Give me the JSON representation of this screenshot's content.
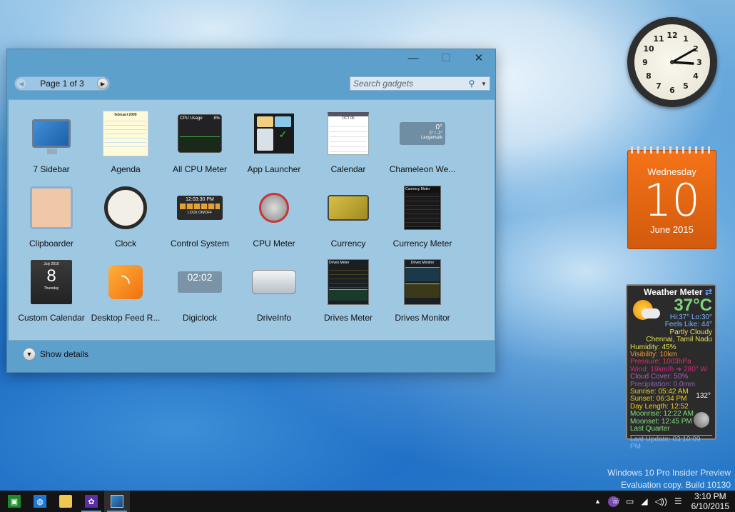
{
  "desktop": {
    "watermark_line1": "Windows 10 Pro Insider Preview",
    "watermark_line2": "Evaluation copy. Build 10130"
  },
  "gallery": {
    "caption": {
      "minimize": "—",
      "maximize": "☐",
      "close": "✕"
    },
    "pager": {
      "prev": "◀",
      "next": "▶",
      "text": "Page 1 of 3"
    },
    "search": {
      "placeholder": "Search gadgets",
      "icon": "🔍",
      "dropdown": "▼"
    },
    "gadgets": [
      {
        "name": "7 Sidebar"
      },
      {
        "name": "Agenda"
      },
      {
        "name": "All CPU Meter"
      },
      {
        "name": "App Launcher"
      },
      {
        "name": "Calendar"
      },
      {
        "name": "Chameleon We..."
      },
      {
        "name": "Clipboarder"
      },
      {
        "name": "Clock"
      },
      {
        "name": "Control System"
      },
      {
        "name": "CPU Meter"
      },
      {
        "name": "Currency"
      },
      {
        "name": "Currency Meter"
      },
      {
        "name": "Custom Calendar"
      },
      {
        "name": "Desktop Feed R..."
      },
      {
        "name": "Digiclock"
      },
      {
        "name": "DriveInfo"
      },
      {
        "name": "Drives Meter"
      },
      {
        "name": "Drives Monitor"
      }
    ],
    "thumb_text": {
      "agenda_header": "februari 2009",
      "cpu_title": "CPU Usage",
      "cpu_pct": "8%",
      "calendar_month": "OCT 06",
      "chameleon_temp": "0°",
      "chameleon_range": "2° / -2°",
      "chameleon_city": "Langemark",
      "control_time": "12:03:30 PM",
      "control_lock": "LOCK ON/OFF",
      "currency_meter_title": "Currency Meter",
      "custom_cal_month": "July 2010",
      "custom_cal_day": "8",
      "custom_cal_weekday": "Thursday",
      "digiclock_time": "02:02",
      "drives_meter_title": "Drives Meter",
      "drives_monitor_title": "Drives Monitor"
    },
    "show_details": "Show details"
  },
  "calendar_gadget": {
    "weekday": "Wednesday",
    "day": "10",
    "month_year": "June 2015"
  },
  "clock_gadget": {
    "time": "3:10",
    "numerals": [
      "12",
      "1",
      "2",
      "3",
      "4",
      "5",
      "6",
      "7",
      "8",
      "9",
      "10",
      "11"
    ]
  },
  "weather": {
    "title": "Weather Meter",
    "temp": "37°C",
    "hilo": "Hi:37° Lo:30°",
    "feels": "Feels Like: 44°",
    "condition": "Partly Cloudy",
    "location": "Chennai, Tamil Nadu",
    "humidity": "Humidity: 45%",
    "visibility": "Visibility: 10km",
    "pressure": "Pressure: 1003hPa",
    "wind": "Wind: 19km/h ➜ 280° W",
    "cloud": "Cloud Cover: 50%",
    "precip": "Precipitation: 0.0mm",
    "sunrise": "Sunrise: 05:42 AM",
    "sunset": "Sunset: 06:34 PM",
    "sun_angle": "132°",
    "day_length": "Day Length: 12:52",
    "moonrise": "Moonrise: 12:22 AM",
    "moonset": "Moonset: 12:45 PM",
    "moon_phase": "Last Quarter",
    "last_update": "Last Update: 03:10:09 PM",
    "colors": {
      "temp": "#7ed27e",
      "blue": "#7fb8ff",
      "yellow": "#e8e050",
      "orange": "#f0a030",
      "red": "#e0306a",
      "purple": "#b060c0",
      "green": "#80e080"
    }
  },
  "taskbar": {
    "items": [
      {
        "name": "store",
        "glyph": "🛍"
      },
      {
        "name": "edge",
        "glyph": "🌐"
      },
      {
        "name": "explorer",
        "glyph": "📁"
      },
      {
        "name": "settings",
        "glyph": "⚙"
      },
      {
        "name": "gadgets",
        "glyph": "▦"
      }
    ],
    "tray": {
      "chevron": "▲",
      "viber": "☏",
      "power": "🔌",
      "wifi": "📶",
      "volume": "🔊",
      "notify": "🗨"
    },
    "time": "3:10 PM",
    "date": "6/10/2015"
  }
}
